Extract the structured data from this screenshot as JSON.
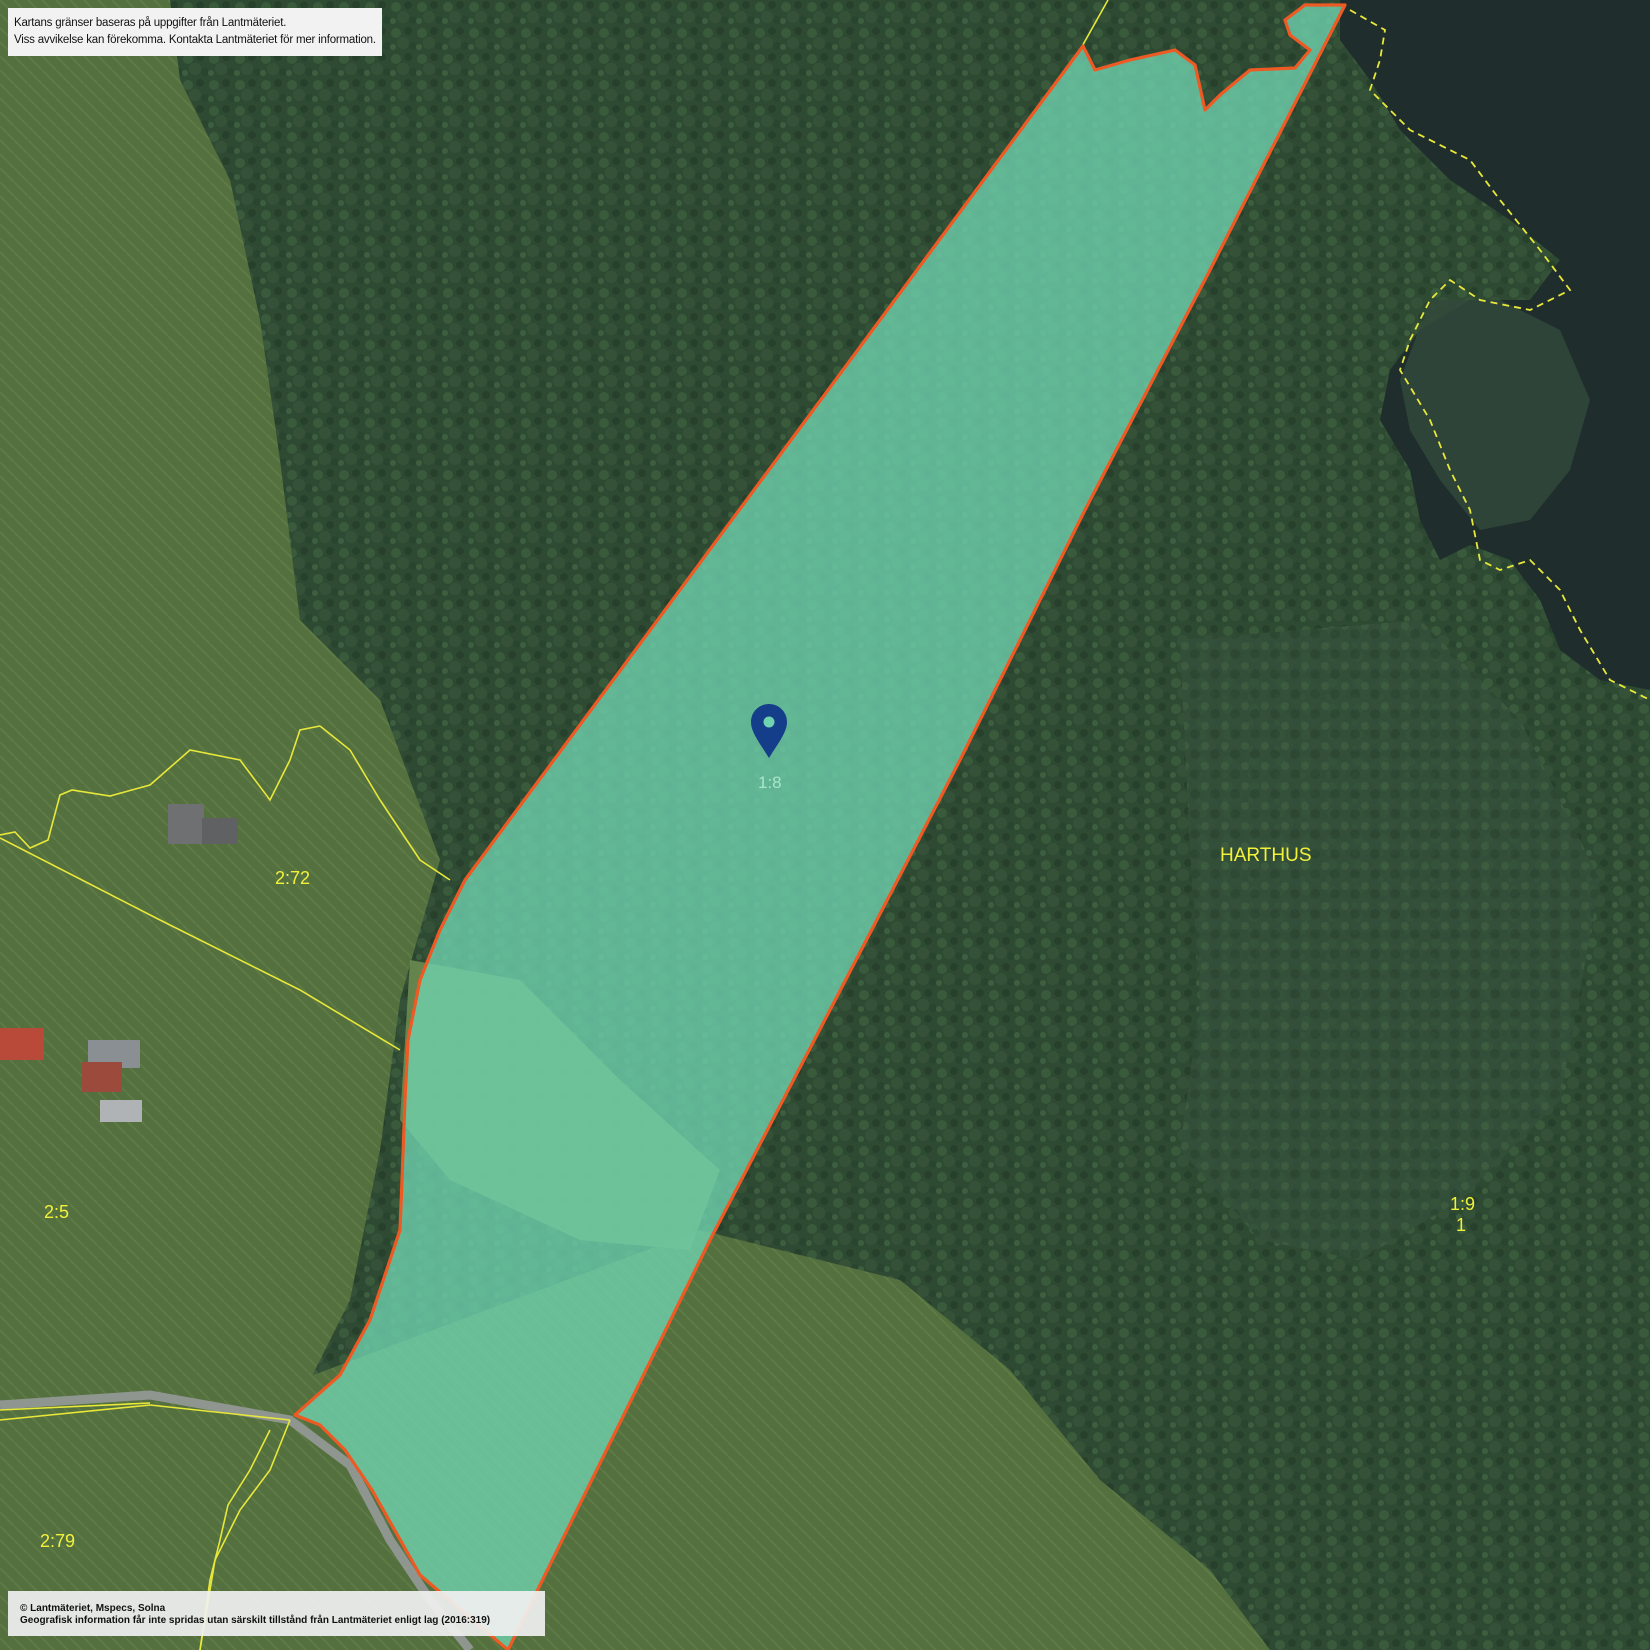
{
  "disclaimer": {
    "line1": "Kartans gränser baseras på uppgifter från Lantmäteriet.",
    "line2": "Viss avvikelse kan förekomma. Kontakta Lantmäteriet för mer information."
  },
  "copyright": {
    "line1": "© Lantmäteriet, Mspecs, Solna",
    "line2": "Geografisk information får inte spridas utan särskilt tillstånd från Lantmäteriet enligt lag (2016:319)"
  },
  "selected_parcel": {
    "label": "1:8",
    "fill_color": "#6fd3b0",
    "border_color": "#ee5a24"
  },
  "region": {
    "name": "HARTHUS"
  },
  "parcels": [
    {
      "id": "p-272",
      "label": "2:72"
    },
    {
      "id": "p-25",
      "label": "2:5"
    },
    {
      "id": "p-279",
      "label": "2:79"
    },
    {
      "id": "p-19",
      "label": "1:9"
    },
    {
      "id": "p-1",
      "label": "1"
    }
  ],
  "colors": {
    "boundary": "#e8e83a",
    "pin": "#153e8a",
    "forest": "#2f4a33",
    "field": "#55703f",
    "water": "#1d2a2a"
  },
  "icons": {
    "pin": "location-pin-icon"
  }
}
